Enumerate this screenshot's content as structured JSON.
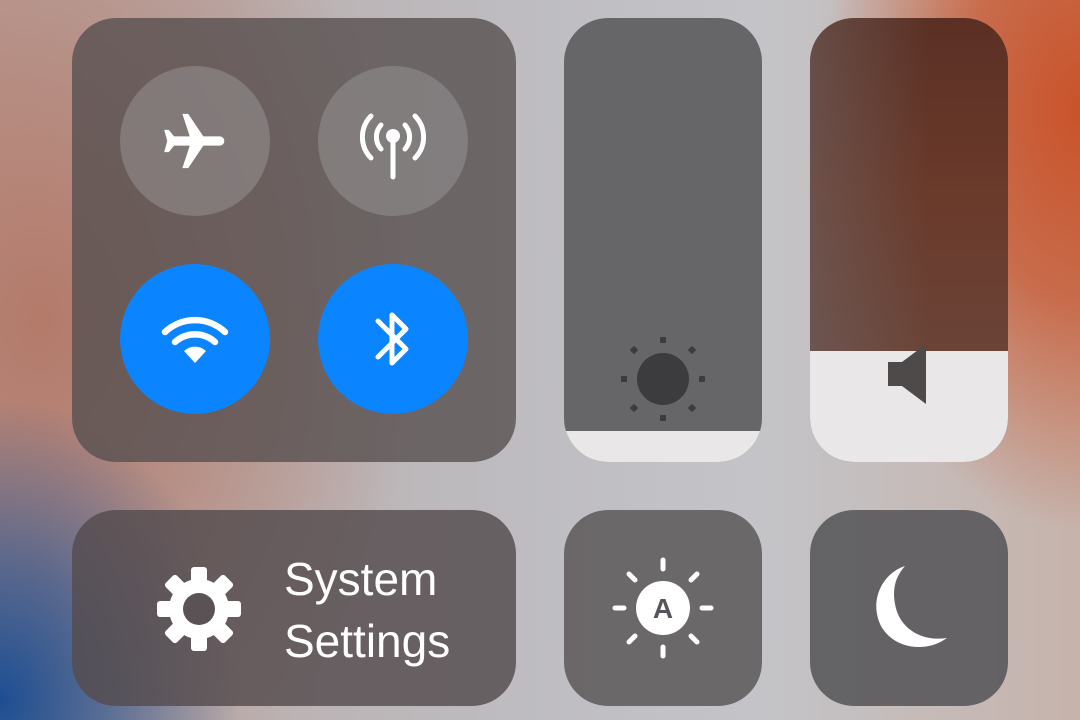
{
  "connectivity": {
    "airplane": {
      "icon": "airplane-icon",
      "state": "off"
    },
    "cellular": {
      "icon": "cellular-antenna-icon",
      "state": "off"
    },
    "wifi": {
      "icon": "wifi-icon",
      "state": "on"
    },
    "bluetooth": {
      "icon": "bluetooth-icon",
      "state": "on"
    }
  },
  "brightness": {
    "icon": "sun-icon",
    "level": 0.07
  },
  "volume": {
    "icon": "speaker-icon",
    "level": 0.25
  },
  "settings": {
    "icon": "gear-icon",
    "label_line1": "System",
    "label_line2": "Settings"
  },
  "auto_brightness": {
    "icon": "auto-brightness-icon",
    "letter": "A"
  },
  "do_not_disturb": {
    "icon": "moon-icon"
  },
  "colors": {
    "active_blue": "#0a84ff",
    "slider_fill": "#e9e7e8",
    "icon_white": "#ffffff"
  }
}
